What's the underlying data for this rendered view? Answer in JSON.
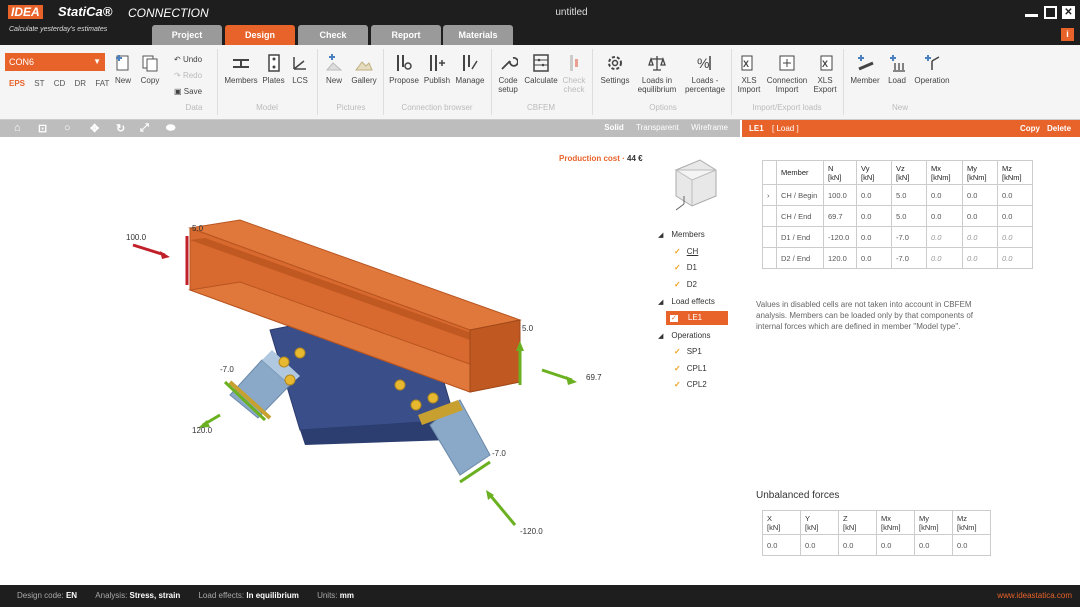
{
  "app": {
    "logo_box": "IDEA",
    "logo_rest": "StatiCa®",
    "module": "CONNECTION",
    "tagline": "Calculate yesterday's estimates",
    "doc_title": "untitled"
  },
  "tabs": [
    {
      "label": "Project",
      "active": false
    },
    {
      "label": "Design",
      "active": true
    },
    {
      "label": "Check",
      "active": false
    },
    {
      "label": "Report",
      "active": false
    },
    {
      "label": "Materials",
      "active": false
    }
  ],
  "ribbon": {
    "connection": "CON6",
    "analysis_types": [
      "EPS",
      "ST",
      "CD",
      "DR",
      "FAT"
    ],
    "new": "New",
    "copy": "Copy",
    "undo": "Undo",
    "redo": "Redo",
    "save": "Save",
    "groups": {
      "data": "Data",
      "model": "Model",
      "pictures": "Pictures",
      "browser": "Connection browser",
      "cbfem": "CBFEM",
      "options": "Options",
      "import_export": "Import/Export loads",
      "new": "New"
    },
    "members": "Members",
    "plates": "Plates",
    "lcs": "LCS",
    "new_pic": "New",
    "gallery": "Gallery",
    "propose": "Propose",
    "publish": "Publish",
    "manage": "Manage",
    "code_setup_1": "Code",
    "code_setup_2": "setup",
    "calculate": "Calculate",
    "check_1": "Check",
    "check_2": "check",
    "settings": "Settings",
    "loads_eq_1": "Loads in",
    "loads_eq_2": "equilibrium",
    "loads_pct_1": "Loads -",
    "loads_pct_2": "percentage",
    "xls_import_1": "XLS",
    "xls_import_2": "Import",
    "conn_import_1": "Connection",
    "conn_import_2": "Import",
    "xls_export_1": "XLS",
    "xls_export_2": "Export",
    "member": "Member",
    "load": "Load",
    "operation": "Operation"
  },
  "viewport": {
    "modes": [
      "Solid",
      "Transparent",
      "Wireframe"
    ],
    "production_cost_label": "Production cost",
    "production_cost_value": "44 €",
    "labels": {
      "ch_begin_n": "100.0",
      "ch_begin_vz": "5.0",
      "ch_end_vz": "5.0",
      "ch_end_n": "69.7",
      "d1_n": "-7.0",
      "d1_n2": "120.0",
      "d2_n": "-7.0",
      "d2_n2": "-120.0"
    }
  },
  "tree": {
    "members_label": "Members",
    "members": [
      "CH",
      "D1",
      "D2"
    ],
    "load_effects_label": "Load effects",
    "load_effects": [
      "LE1"
    ],
    "operations_label": "Operations",
    "operations": [
      "SP1",
      "CPL1",
      "CPL2"
    ]
  },
  "right_panel": {
    "header_id": "LE1",
    "header_type": "[ Load ]",
    "copy": "Copy",
    "delete": "Delete",
    "columns": [
      "Member",
      "N\n[kN]",
      "Vy\n[kN]",
      "Vz\n[kN]",
      "Mx\n[kNm]",
      "My\n[kNm]",
      "Mz\n[kNm]"
    ],
    "rows": [
      [
        "CH / Begin",
        "100.0",
        "0.0",
        "5.0",
        "0.0",
        "0.0",
        "0.0"
      ],
      [
        "CH / End",
        "69.7",
        "0.0",
        "5.0",
        "0.0",
        "0.0",
        "0.0"
      ],
      [
        "D1 / End",
        "-120.0",
        "0.0",
        "-7.0",
        "0.0",
        "0.0",
        "0.0"
      ],
      [
        "D2 / End",
        "120.0",
        "0.0",
        "-7.0",
        "0.0",
        "0.0",
        "0.0"
      ]
    ],
    "note": "Values in disabled cells are not taken into account in CBFEM analysis. Members can be loaded only by that components of internal forces which are defined in member \"Model type\".",
    "unbalanced_title": "Unbalanced forces",
    "unbalanced_columns": [
      "X\n[kN]",
      "Y\n[kN]",
      "Z\n[kN]",
      "Mx\n[kNm]",
      "My\n[kNm]",
      "Mz\n[kNm]"
    ],
    "unbalanced_values": [
      "0.0",
      "0.0",
      "0.0",
      "0.0",
      "0.0",
      "0.0"
    ]
  },
  "status": {
    "design_code_label": "Design code:",
    "design_code": "EN",
    "analysis_label": "Analysis:",
    "analysis": "Stress, strain",
    "load_effects_label": "Load effects:",
    "load_effects": "In equilibrium",
    "units_label": "Units:",
    "units": "mm",
    "website": "www.ideastatica.com"
  },
  "colors": {
    "accent": "#e8632a",
    "steel_orange": "#d8692f",
    "plate_blue": "#3a4f8a",
    "brace_blue": "#8aa8c8",
    "force_red": "#c0202a",
    "force_green": "#6ab020"
  }
}
